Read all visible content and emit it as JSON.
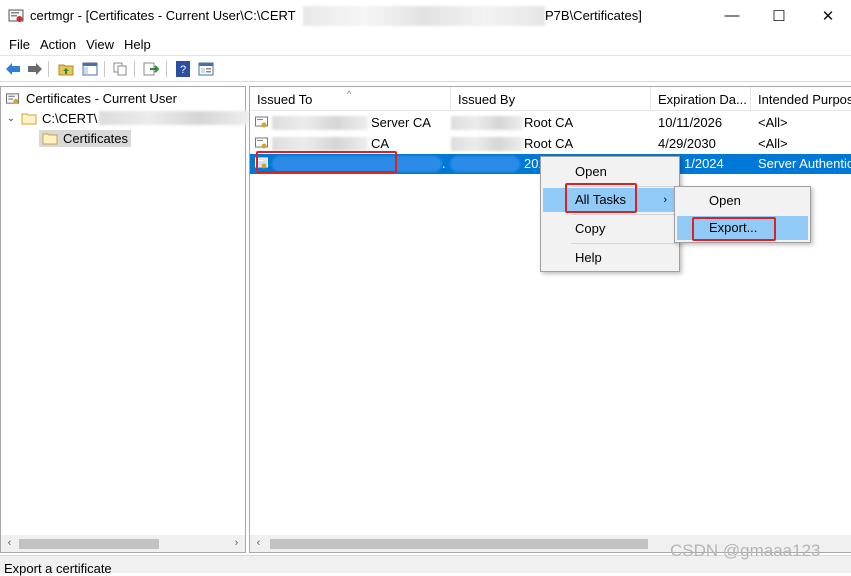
{
  "window": {
    "title_prefix": "certmgr - [Certificates - Current User\\C:\\CERT",
    "title_suffix": "P7B\\Certificates]",
    "minimize_glyph": "—",
    "maximize_glyph": "☐",
    "close_glyph": "✕"
  },
  "menubar": {
    "items": [
      "File",
      "Action",
      "View",
      "Help"
    ]
  },
  "toolbar": {
    "icons": [
      "back-arrow-icon",
      "forward-arrow-icon",
      "up-folder-icon",
      "show-hide-tree-icon",
      "copy-icon",
      "export-list-icon",
      "help-icon",
      "properties-icon"
    ],
    "accent": "#1f6fd0"
  },
  "tree": {
    "root_label": "Certificates - Current User",
    "file_label": "C:\\CERT\\",
    "folder_label": "Certificates",
    "expand_glyph": "⌄"
  },
  "columns": [
    "Issued To",
    "Issued By",
    "Expiration Da...",
    "Intended Purpos"
  ],
  "rows": [
    {
      "issued_to": "Server CA",
      "issued_by": "Root CA",
      "expiration": "10/11/2026",
      "purpose": "<All>"
    },
    {
      "issued_to": "CA",
      "issued_by": "Root CA",
      "expiration": "4/29/2030",
      "purpose": "<All>"
    },
    {
      "issued_to": ".",
      "issued_by": "201",
      "expiration": "1/2024",
      "purpose": "Server Authentic"
    }
  ],
  "context_menu": {
    "items": [
      "Open",
      "All Tasks",
      "Copy",
      "Help"
    ],
    "submenu_glyph": "›"
  },
  "submenu": {
    "items": [
      "Open",
      "Export..."
    ]
  },
  "scroll": {
    "left_glyph": "‹",
    "right_glyph": "›"
  },
  "status": {
    "text": "Export a certificate"
  },
  "watermark": {
    "text": "CSDN @gmaaa123"
  },
  "colors": {
    "selection": "#0078d7",
    "menu_highlight": "#91c9f7",
    "annotation": "#e02020"
  }
}
